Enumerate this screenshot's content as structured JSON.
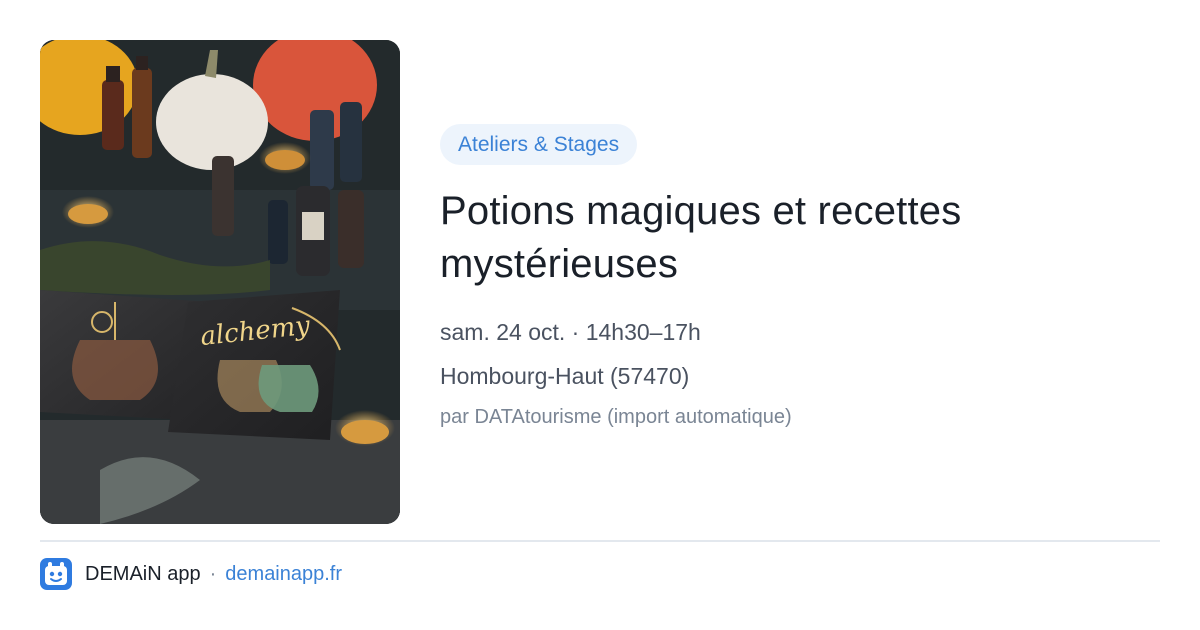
{
  "event": {
    "category": "Ateliers & Stages",
    "title": "Potions magiques et recettes mystérieuses",
    "date": "sam. 24 oct. · 14h30–17h",
    "location": "Hombourg-Haut (57470)",
    "source": "par DATAtourisme (import automatique)",
    "image_text": "alchemy"
  },
  "footer": {
    "app_name": "DEMAiN app",
    "separator": "·",
    "link": "demainapp.fr"
  },
  "colors": {
    "accent": "#3b82d6",
    "badge_bg": "#edf4fc",
    "title": "#1a2029",
    "muted": "#7a8594"
  },
  "icons": {
    "app_logo": "demain-app-logo-icon"
  }
}
